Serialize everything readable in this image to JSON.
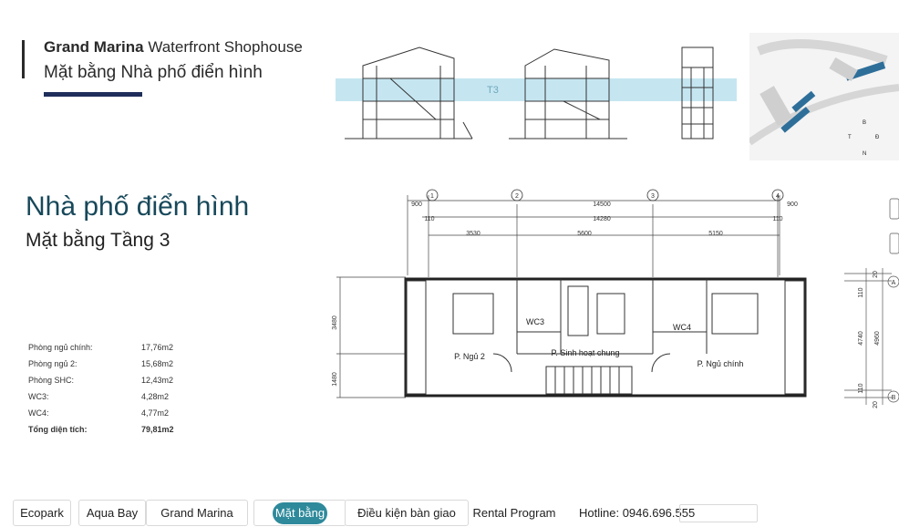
{
  "header": {
    "brand_bold": "Grand Marina",
    "brand_rest": " Waterfront Shophouse",
    "subtitle": "Mặt bằng Nhà phố điển hình"
  },
  "content": {
    "title": "Nhà phố điển hình",
    "floor": "Mặt bằng Tầng 3",
    "areas": [
      {
        "label": "Phòng ngủ chính:",
        "value": "17,76m2"
      },
      {
        "label": "Phòng ngủ 2:",
        "value": "15,68m2"
      },
      {
        "label": "Phòng SHC:",
        "value": "12,43m2"
      },
      {
        "label": "WC3:",
        "value": "4,28m2"
      },
      {
        "label": "WC4:",
        "value": "4,77m2"
      },
      {
        "label": "Tổng diện tích:",
        "value": "79,81m2"
      }
    ]
  },
  "section": {
    "level_label": "T3"
  },
  "site_map": {
    "compass_b": "B",
    "compass_t": "T",
    "compass_d": "Đ",
    "compass_n": "N"
  },
  "plan": {
    "grid_labels": [
      "1",
      "2",
      "3",
      "4"
    ],
    "dim_900_left": "900",
    "dim_14500": "14500",
    "dim_900_right": "900",
    "dim_110_left": "110",
    "dim_14280": "14280",
    "dim_110_right": "110",
    "dim_3530": "3530",
    "dim_5600": "5600",
    "dim_5150": "5150",
    "dim_3480": "3480",
    "dim_1480": "1480",
    "room_wc3": "WC3",
    "room_wc4": "WC4",
    "room_bed2": "P. Ngủ 2",
    "room_living": "P. Sinh hoạt chung",
    "room_master": "P. Ngủ chính",
    "right_dims": [
      "20",
      "110",
      "4740",
      "4960",
      "110",
      "20"
    ],
    "axis_a": "A",
    "axis_b": "B"
  },
  "nav": {
    "items": [
      "Ecopark",
      "Aqua Bay",
      "Grand Marina",
      "Mặt bằng",
      "Điều kiện bàn giao",
      "Rental Program"
    ],
    "active": "Mặt bằng",
    "hotline": "Hotline: 0946.696.555"
  },
  "colors": {
    "title": "#17485a",
    "accent": "#2e8a9b",
    "underline": "#1f2d5a",
    "section_band": "#bfe3ef"
  }
}
